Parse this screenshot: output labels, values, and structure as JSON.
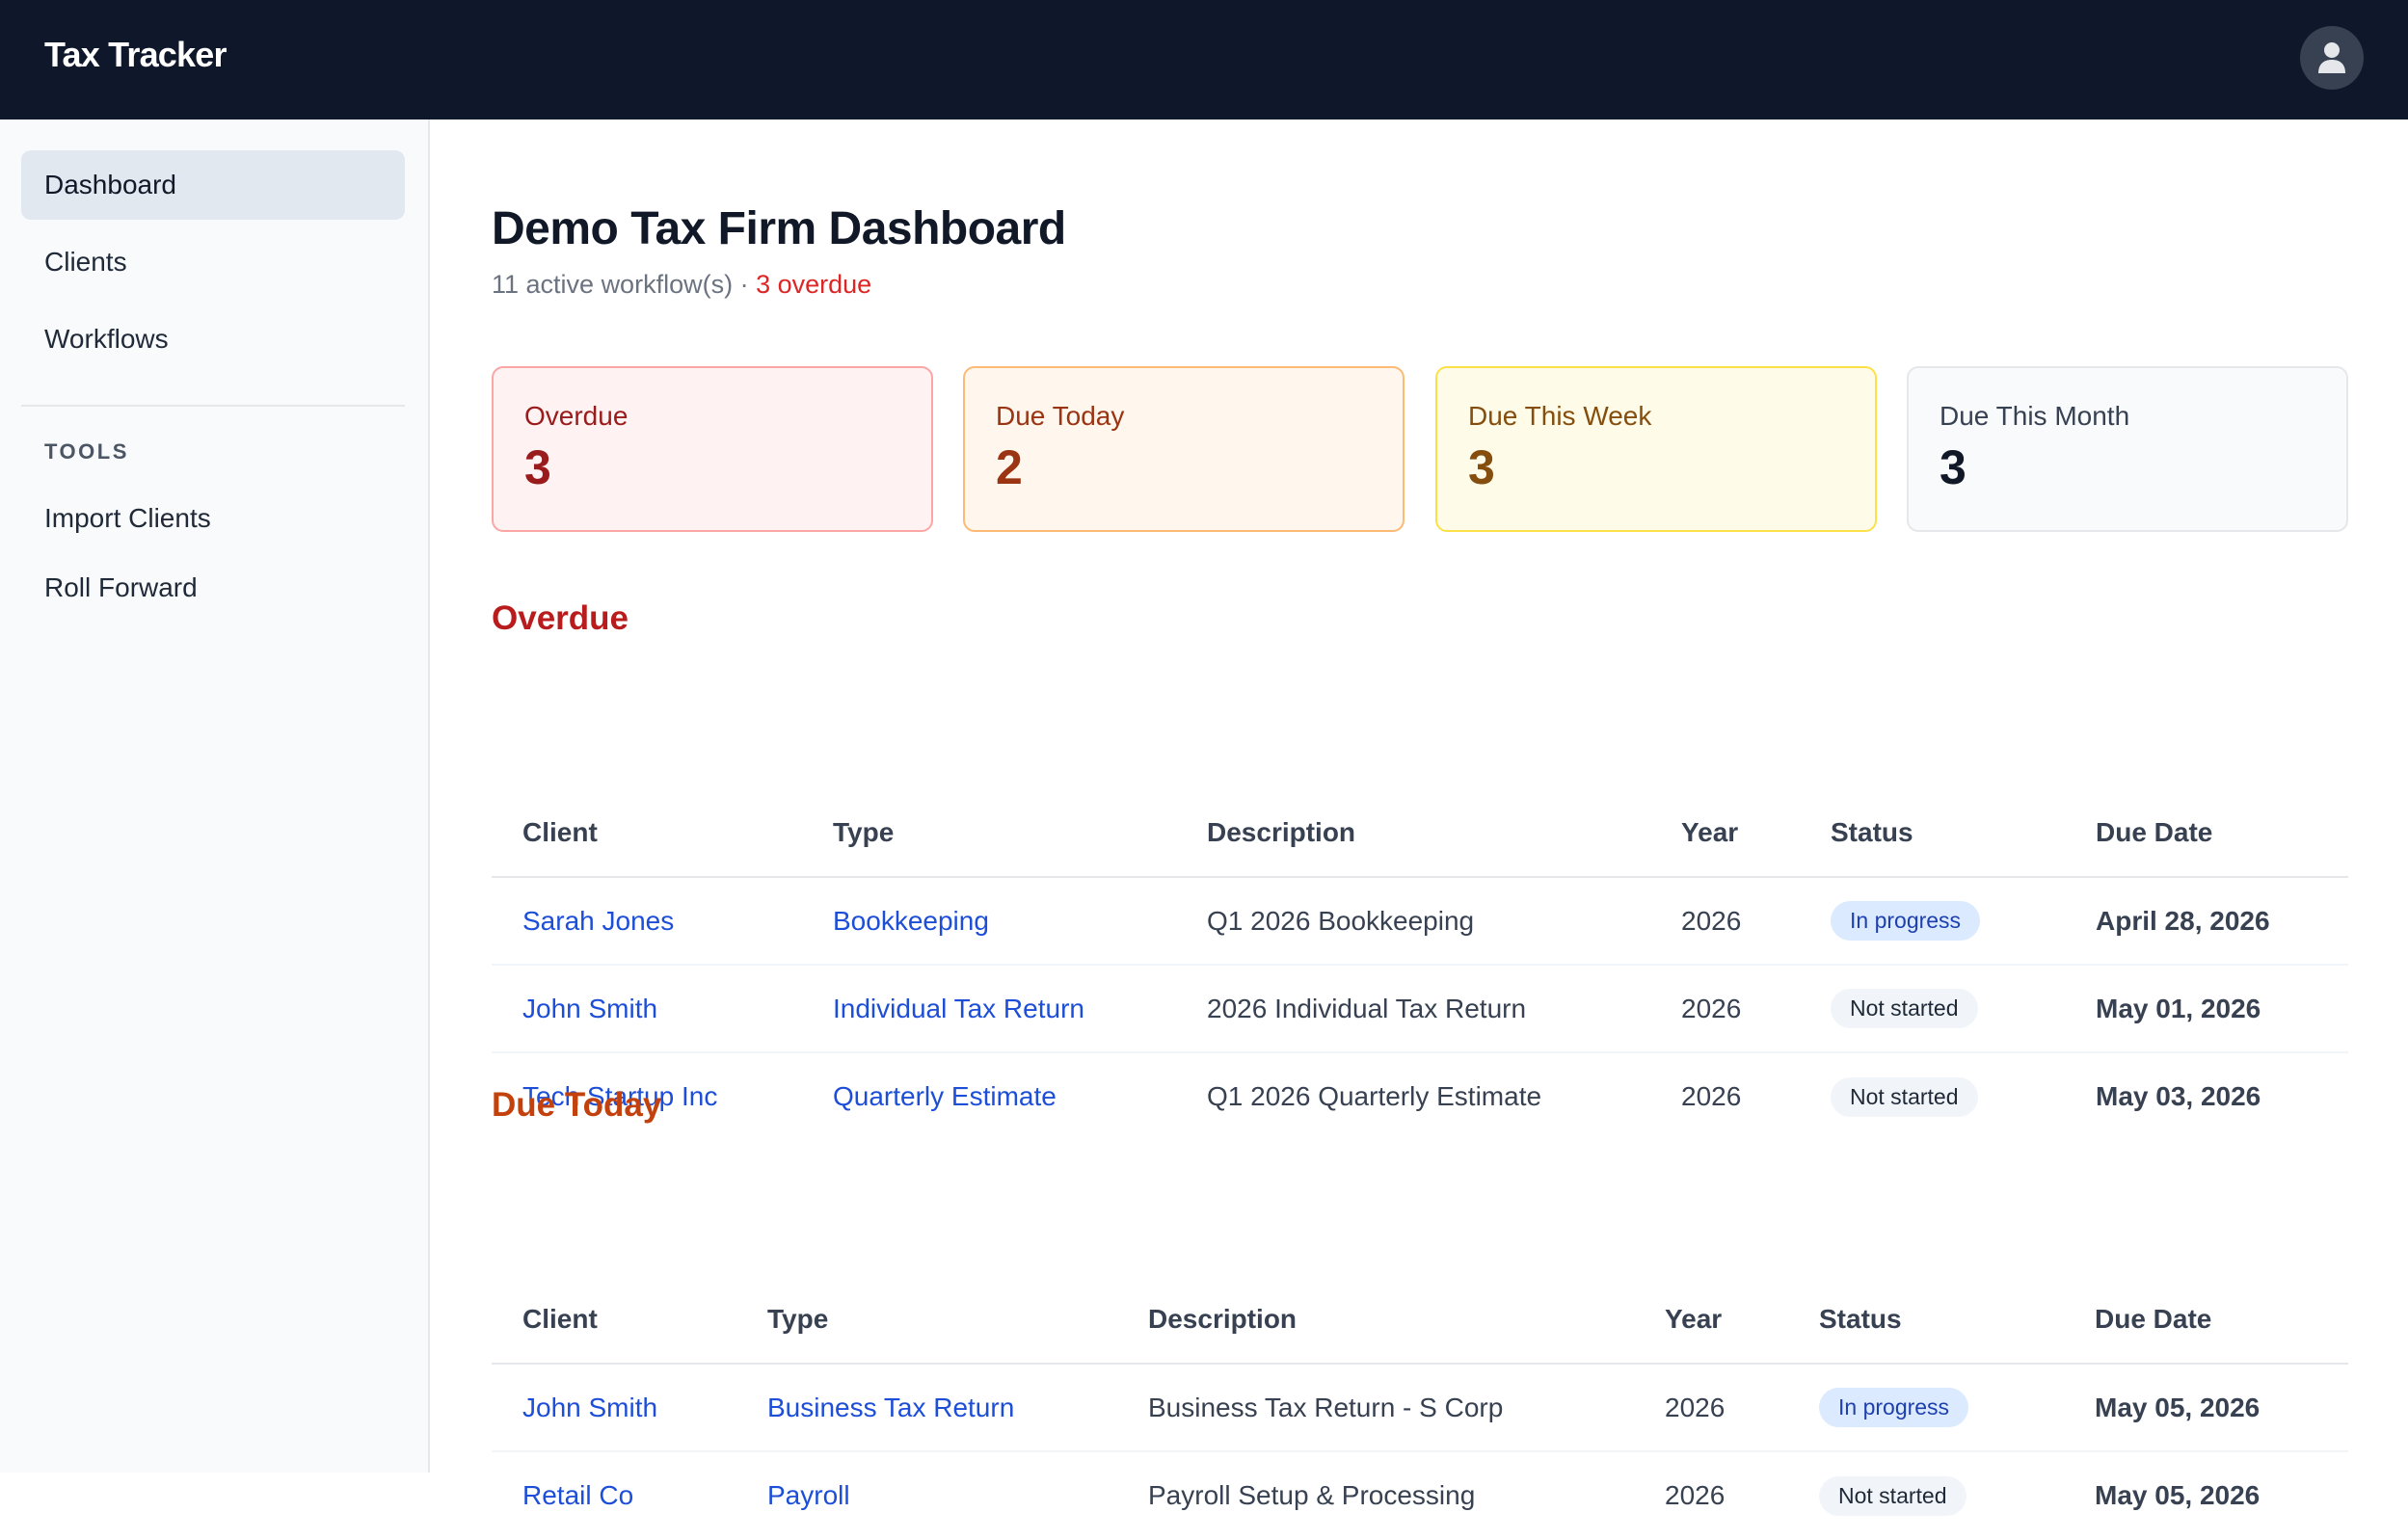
{
  "app": {
    "title": "Tax Tracker",
    "avatar_icon": "user-icon",
    "colors": {
      "topbar": "#0f172a",
      "link": "#1d4ed8",
      "overdue": "#dc2626",
      "due_today": "#ea580c"
    }
  },
  "sidebar": {
    "items": [
      {
        "label": "Dashboard",
        "active": true
      },
      {
        "label": "Clients",
        "active": false
      },
      {
        "label": "Workflows",
        "active": false
      }
    ],
    "tools_heading": "TOOLS",
    "tools": [
      {
        "label": "Import Clients"
      },
      {
        "label": "Roll Forward"
      }
    ]
  },
  "page": {
    "title": "Demo Tax Firm Dashboard",
    "subtitle_prefix": "11 active workflow(s) · ",
    "subtitle_overdue": "3 overdue"
  },
  "cards": [
    {
      "label": "Overdue",
      "value": "3"
    },
    {
      "label": "Due Today",
      "value": "2"
    },
    {
      "label": "Due This Week",
      "value": "3"
    },
    {
      "label": "Due This Month",
      "value": "3"
    }
  ],
  "columns": [
    "Client",
    "Type",
    "Description",
    "Year",
    "Status",
    "Due Date"
  ],
  "overdue": {
    "title": "Overdue",
    "rows": [
      {
        "client": "Sarah Jones",
        "type": "Bookkeeping",
        "description": "Q1 2026 Bookkeeping",
        "year": "2026",
        "status": "In progress",
        "due": "April 28, 2026"
      },
      {
        "client": "John Smith",
        "type": "Individual Tax Return",
        "description": "2026 Individual Tax Return",
        "year": "2026",
        "status": "Not started",
        "due": "May 01, 2026"
      },
      {
        "client": "Tech Startup Inc",
        "type": "Quarterly Estimate",
        "description": "Q1 2026 Quarterly Estimate",
        "year": "2026",
        "status": "Not started",
        "due": "May 03, 2026"
      }
    ]
  },
  "due_today": {
    "title": "Due Today",
    "rows": [
      {
        "client": "John Smith",
        "type": "Business Tax Return",
        "description": "Business Tax Return - S Corp",
        "year": "2026",
        "status": "In progress",
        "due": "May 05, 2026"
      },
      {
        "client": "Retail Co",
        "type": "Payroll",
        "description": "Payroll Setup & Processing",
        "year": "2026",
        "status": "Not started",
        "due": "May 05, 2026"
      }
    ]
  }
}
